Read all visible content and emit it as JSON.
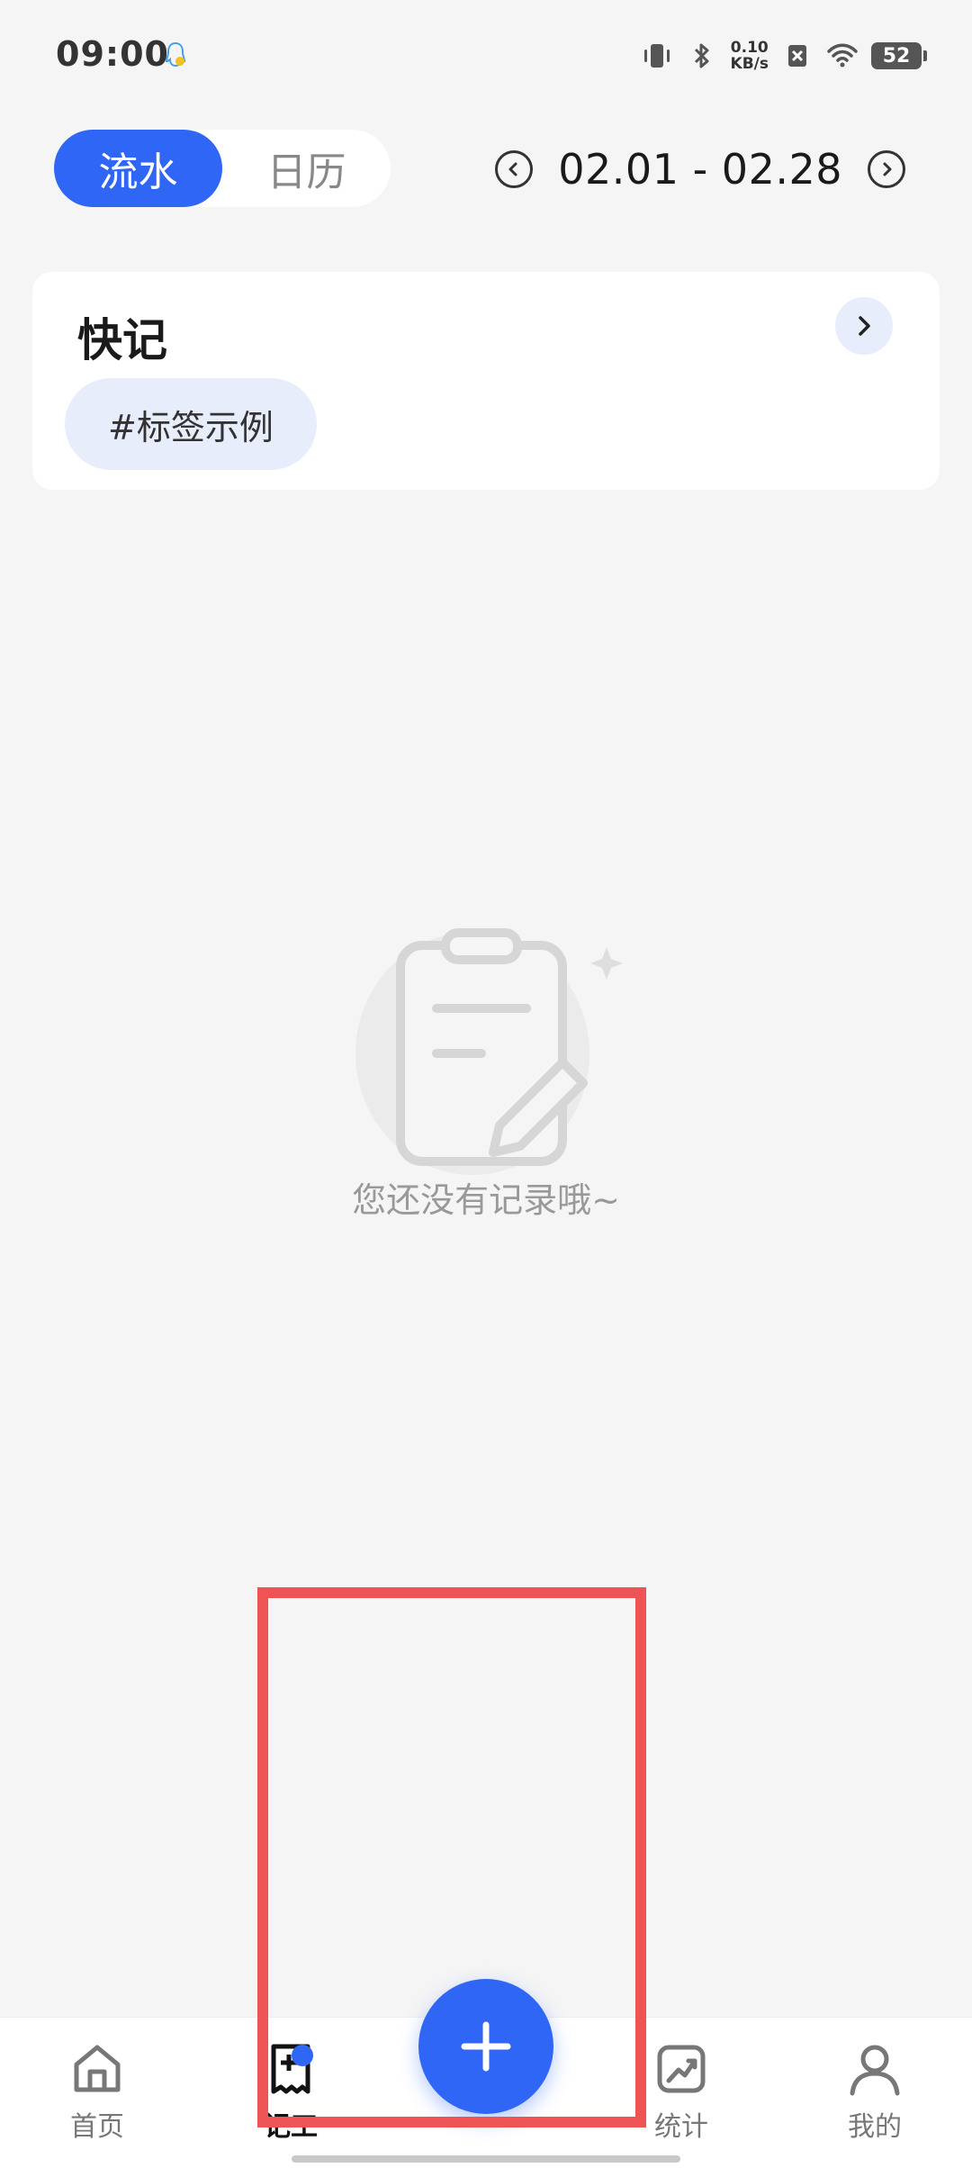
{
  "status_bar": {
    "time": "09:00",
    "net_speed_value": "0.10",
    "net_speed_unit": "KB/s",
    "battery": "52",
    "icons": [
      "qq-notification-icon",
      "vibrate-icon",
      "bluetooth-icon",
      "no-sim-icon",
      "wifi-icon",
      "battery-icon"
    ]
  },
  "view_toggle": {
    "active_label": "流水",
    "inactive_label": "日历"
  },
  "date_range": {
    "text": "02.01 - 02.28"
  },
  "quick_note": {
    "title": "快记",
    "tag": "#标签示例"
  },
  "empty_state": {
    "message": "您还没有记录哦~",
    "icon": "clipboard-edit-icon"
  },
  "bottom_nav": {
    "items": [
      {
        "label": "首页",
        "icon": "home-icon"
      },
      {
        "label": "记工",
        "icon": "record-icon"
      },
      {
        "label": "统计",
        "icon": "stats-icon"
      },
      {
        "label": "我的",
        "icon": "profile-icon"
      }
    ],
    "fab_icon": "plus-icon"
  },
  "colors": {
    "accent": "#2f66f6",
    "background": "#f5f5f5",
    "highlight": "#ee5453",
    "chip": "#e8edfc"
  }
}
